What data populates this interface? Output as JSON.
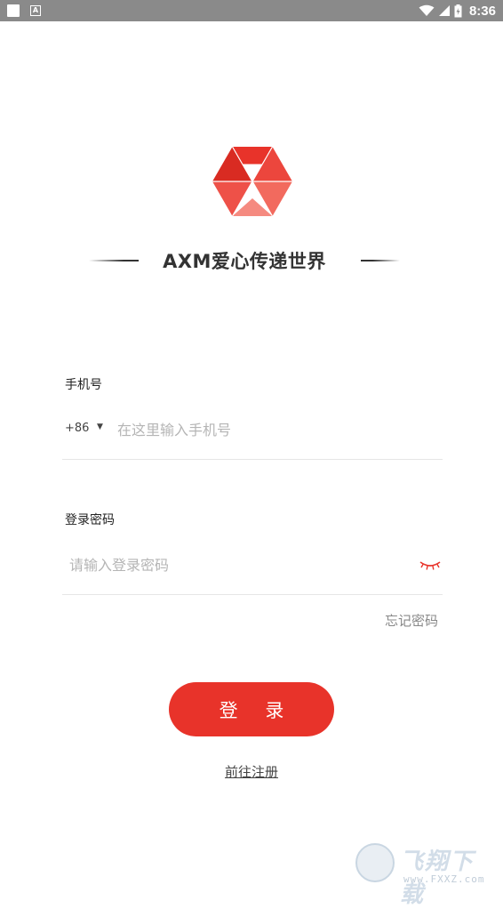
{
  "status_bar": {
    "time": "8:36",
    "left_icons": [
      "notification-square-icon",
      "app-a-icon"
    ],
    "right_icons": [
      "wifi-icon",
      "signal-icon",
      "battery-icon"
    ],
    "app_icon_letter": "A"
  },
  "brand": {
    "title": "AXM爱心传递世界",
    "logo_colors": [
      "#e8332a",
      "#f26a5e"
    ]
  },
  "form": {
    "phone_label": "手机号",
    "country_code": "+86",
    "country_caret": "▼",
    "phone_placeholder": "在这里输入手机号",
    "password_label": "登录密码",
    "password_placeholder": "请输入登录密码",
    "forgot_password": "忘记密码",
    "login_button": "登 录",
    "register_link": "前往注册"
  },
  "watermark": {
    "text": "飞翔下载",
    "url": "www.FXXZ.com"
  },
  "colors": {
    "accent": "#e8332a",
    "status_bar": "#8a8a8a",
    "placeholder": "#b5b5b5",
    "divider": "#e6e6e6"
  }
}
